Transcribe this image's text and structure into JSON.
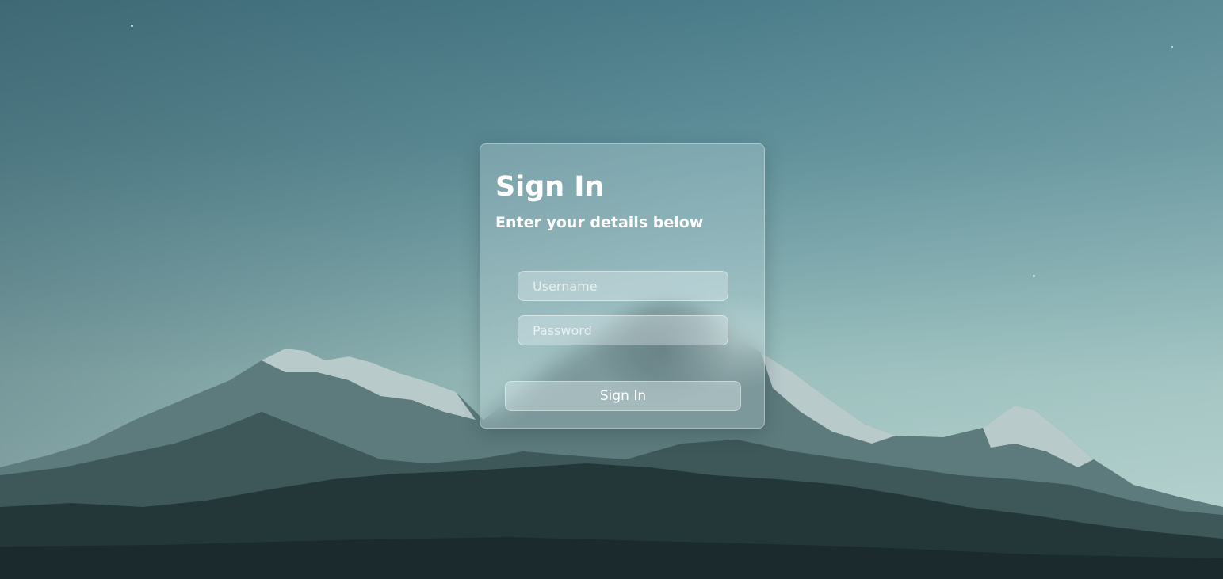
{
  "login": {
    "title": "Sign In",
    "subtitle": "Enter your details below",
    "username_placeholder": "Username",
    "password_placeholder": "Password",
    "submit_label": "Sign In"
  },
  "background": {
    "sky_top_color": "#4a7c89",
    "sky_bottom_color": "#b4d1cd",
    "ridge_color": "#203336"
  }
}
